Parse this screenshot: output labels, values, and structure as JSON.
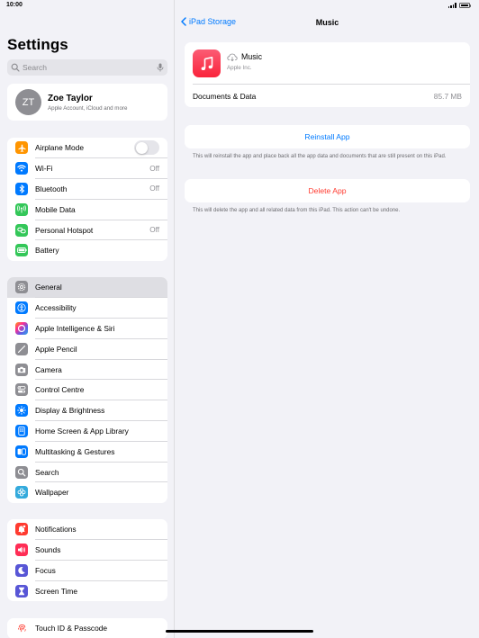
{
  "status_bar": {
    "time": "10:00"
  },
  "sidebar": {
    "title": "Settings",
    "search": {
      "placeholder": "Search"
    },
    "profile": {
      "initials": "ZT",
      "name": "Zoe Taylor",
      "subtitle": "Apple Account, iCloud and more"
    },
    "groups": [
      {
        "items": [
          {
            "label": "Airplane Mode",
            "icon": "airplane-icon",
            "color": "#ff9500",
            "toggle": "off"
          },
          {
            "label": "Wi-Fi",
            "icon": "wifi-icon",
            "color": "#007aff",
            "value": "Off"
          },
          {
            "label": "Bluetooth",
            "icon": "bluetooth-icon",
            "color": "#007aff",
            "value": "Off"
          },
          {
            "label": "Mobile Data",
            "icon": "antenna-icon",
            "color": "#34c759"
          },
          {
            "label": "Personal Hotspot",
            "icon": "hotspot-icon",
            "color": "#34c759",
            "value": "Off"
          },
          {
            "label": "Battery",
            "icon": "battery-icon",
            "color": "#34c759"
          }
        ]
      },
      {
        "items": [
          {
            "label": "General",
            "icon": "gear-icon",
            "color": "#8e8e93",
            "selected": true
          },
          {
            "label": "Accessibility",
            "icon": "accessibility-icon",
            "color": "#007aff"
          },
          {
            "label": "Apple Intelligence & Siri",
            "icon": "siri-icon",
            "color": "#c86ad6"
          },
          {
            "label": "Apple Pencil",
            "icon": "pencil-icon",
            "color": "#8e8e93"
          },
          {
            "label": "Camera",
            "icon": "camera-icon",
            "color": "#8e8e93"
          },
          {
            "label": "Control Centre",
            "icon": "control-centre-icon",
            "color": "#8e8e93"
          },
          {
            "label": "Display & Brightness",
            "icon": "brightness-icon",
            "color": "#007aff"
          },
          {
            "label": "Home Screen & App Library",
            "icon": "home-screen-icon",
            "color": "#007aff"
          },
          {
            "label": "Multitasking & Gestures",
            "icon": "multitasking-icon",
            "color": "#007aff"
          },
          {
            "label": "Search",
            "icon": "search-icon",
            "color": "#8e8e93"
          },
          {
            "label": "Wallpaper",
            "icon": "wallpaper-icon",
            "color": "#34aadc"
          }
        ]
      },
      {
        "items": [
          {
            "label": "Notifications",
            "icon": "bell-icon",
            "color": "#ff3b30"
          },
          {
            "label": "Sounds",
            "icon": "speaker-icon",
            "color": "#ff2d55"
          },
          {
            "label": "Focus",
            "icon": "moon-icon",
            "color": "#5856d6"
          },
          {
            "label": "Screen Time",
            "icon": "hourglass-icon",
            "color": "#5856d6"
          }
        ]
      },
      {
        "items": [
          {
            "label": "Touch ID & Passcode",
            "icon": "fingerprint-icon",
            "color": "#ff3b30"
          }
        ]
      }
    ]
  },
  "main": {
    "back_label": "iPad Storage",
    "title": "Music",
    "app": {
      "name": "Music",
      "vendor": "Apple Inc."
    },
    "documents_label": "Documents & Data",
    "documents_value": "85.7 MB",
    "reinstall_label": "Reinstall App",
    "reinstall_note": "This will reinstall the app and place back all the app data and documents that are still present on this iPad.",
    "delete_label": "Delete App",
    "delete_note": "This will delete the app and all related data from this iPad. This action can't be undone."
  }
}
